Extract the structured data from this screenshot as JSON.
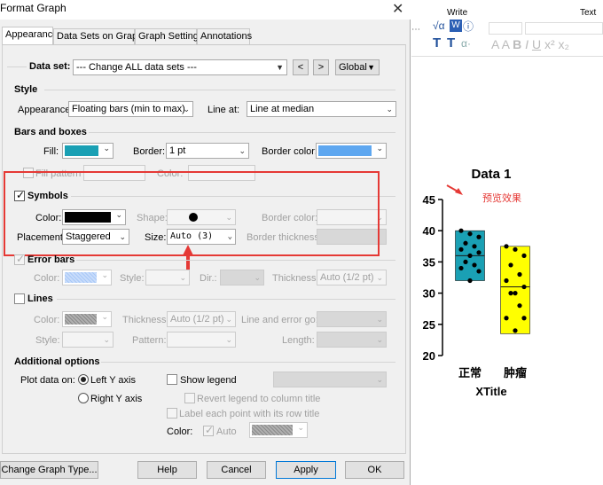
{
  "dialog": {
    "title": "Format Graph",
    "tabs": [
      "Appearance",
      "Data Sets on Graph",
      "Graph Settings",
      "Annotations"
    ],
    "dataset": {
      "label": "Data set:",
      "value": "--- Change ALL data sets ---",
      "prev": "<",
      "next": ">",
      "global": "Global"
    },
    "style": {
      "heading": "Style",
      "appearance_label": "Appearance:",
      "appearance_value": "Floating bars (min to max)",
      "line_at_label": "Line at:",
      "line_at_value": "Line at median"
    },
    "bars": {
      "heading": "Bars and boxes",
      "fill_label": "Fill:",
      "fill_color": "#1aa0b4",
      "border_label": "Border:",
      "border_value": "1 pt",
      "border_color_label": "Border color:",
      "border_color": "#5ea7f0",
      "fill_pattern_label": "Fill pattern",
      "color_label": "Color:"
    },
    "symbols": {
      "heading": "Symbols",
      "color_label": "Color:",
      "color": "#000000",
      "shape_label": "Shape:",
      "border_color_label": "Border color:",
      "placement_label": "Placement:",
      "placement_value": "Staggered",
      "size_label": "Size:",
      "size_value": "Auto (3)",
      "border_thickness_label": "Border thickness:"
    },
    "error_bars": {
      "heading": "Error bars",
      "color_label": "Color:",
      "style_label": "Style:",
      "dir_label": "Dir.:",
      "thickness_label": "Thickness:",
      "thickness_value": "Auto (1/2 pt)"
    },
    "lines": {
      "heading": "Lines",
      "color_label": "Color:",
      "thickness_label": "Thickness:",
      "thickness_value": "Auto (1/2 pt)",
      "line_error_label": "Line and error go:",
      "style_label": "Style:",
      "pattern_label": "Pattern:",
      "length_label": "Length:"
    },
    "additional": {
      "heading": "Additional options",
      "plot_on_label": "Plot data on:",
      "left_axis": "Left Y axis",
      "right_axis": "Right  Y axis",
      "show_legend": "Show legend",
      "revert_legend": "Revert legend to column title",
      "label_each": "Label each point with its row title",
      "color_label": "Color:",
      "auto_label": "Auto"
    },
    "buttons": {
      "change_type": "Change Graph Type...",
      "help": "Help",
      "cancel": "Cancel",
      "apply": "Apply",
      "ok": "OK"
    }
  },
  "ribbon": {
    "write_label": "Write",
    "text_label": "Text"
  },
  "chart_data": {
    "type": "scatter",
    "title": "Data 1",
    "xlabel": "XTitle",
    "ylabel": "",
    "ylim": [
      20,
      45
    ],
    "yticks": [
      20,
      25,
      30,
      35,
      40,
      45
    ],
    "categories": [
      "正常",
      "肿瘤"
    ],
    "bars": [
      {
        "category": "正常",
        "min": 32,
        "max": 40,
        "median": 36,
        "color": "#1aa0b4"
      },
      {
        "category": "肿瘤",
        "min": 23.5,
        "max": 37.5,
        "median": 31,
        "color": "#ffff00"
      }
    ],
    "series": [
      {
        "category": "正常",
        "values": [
          40,
          39.5,
          39,
          38,
          37.5,
          37,
          36.5,
          36,
          35,
          34.5,
          34,
          33.5,
          32
        ]
      },
      {
        "category": "肿瘤",
        "values": [
          37.5,
          37,
          36,
          34.5,
          33,
          32,
          31,
          30,
          30,
          28,
          26,
          26,
          24
        ]
      }
    ],
    "annotation": "预览效果"
  }
}
